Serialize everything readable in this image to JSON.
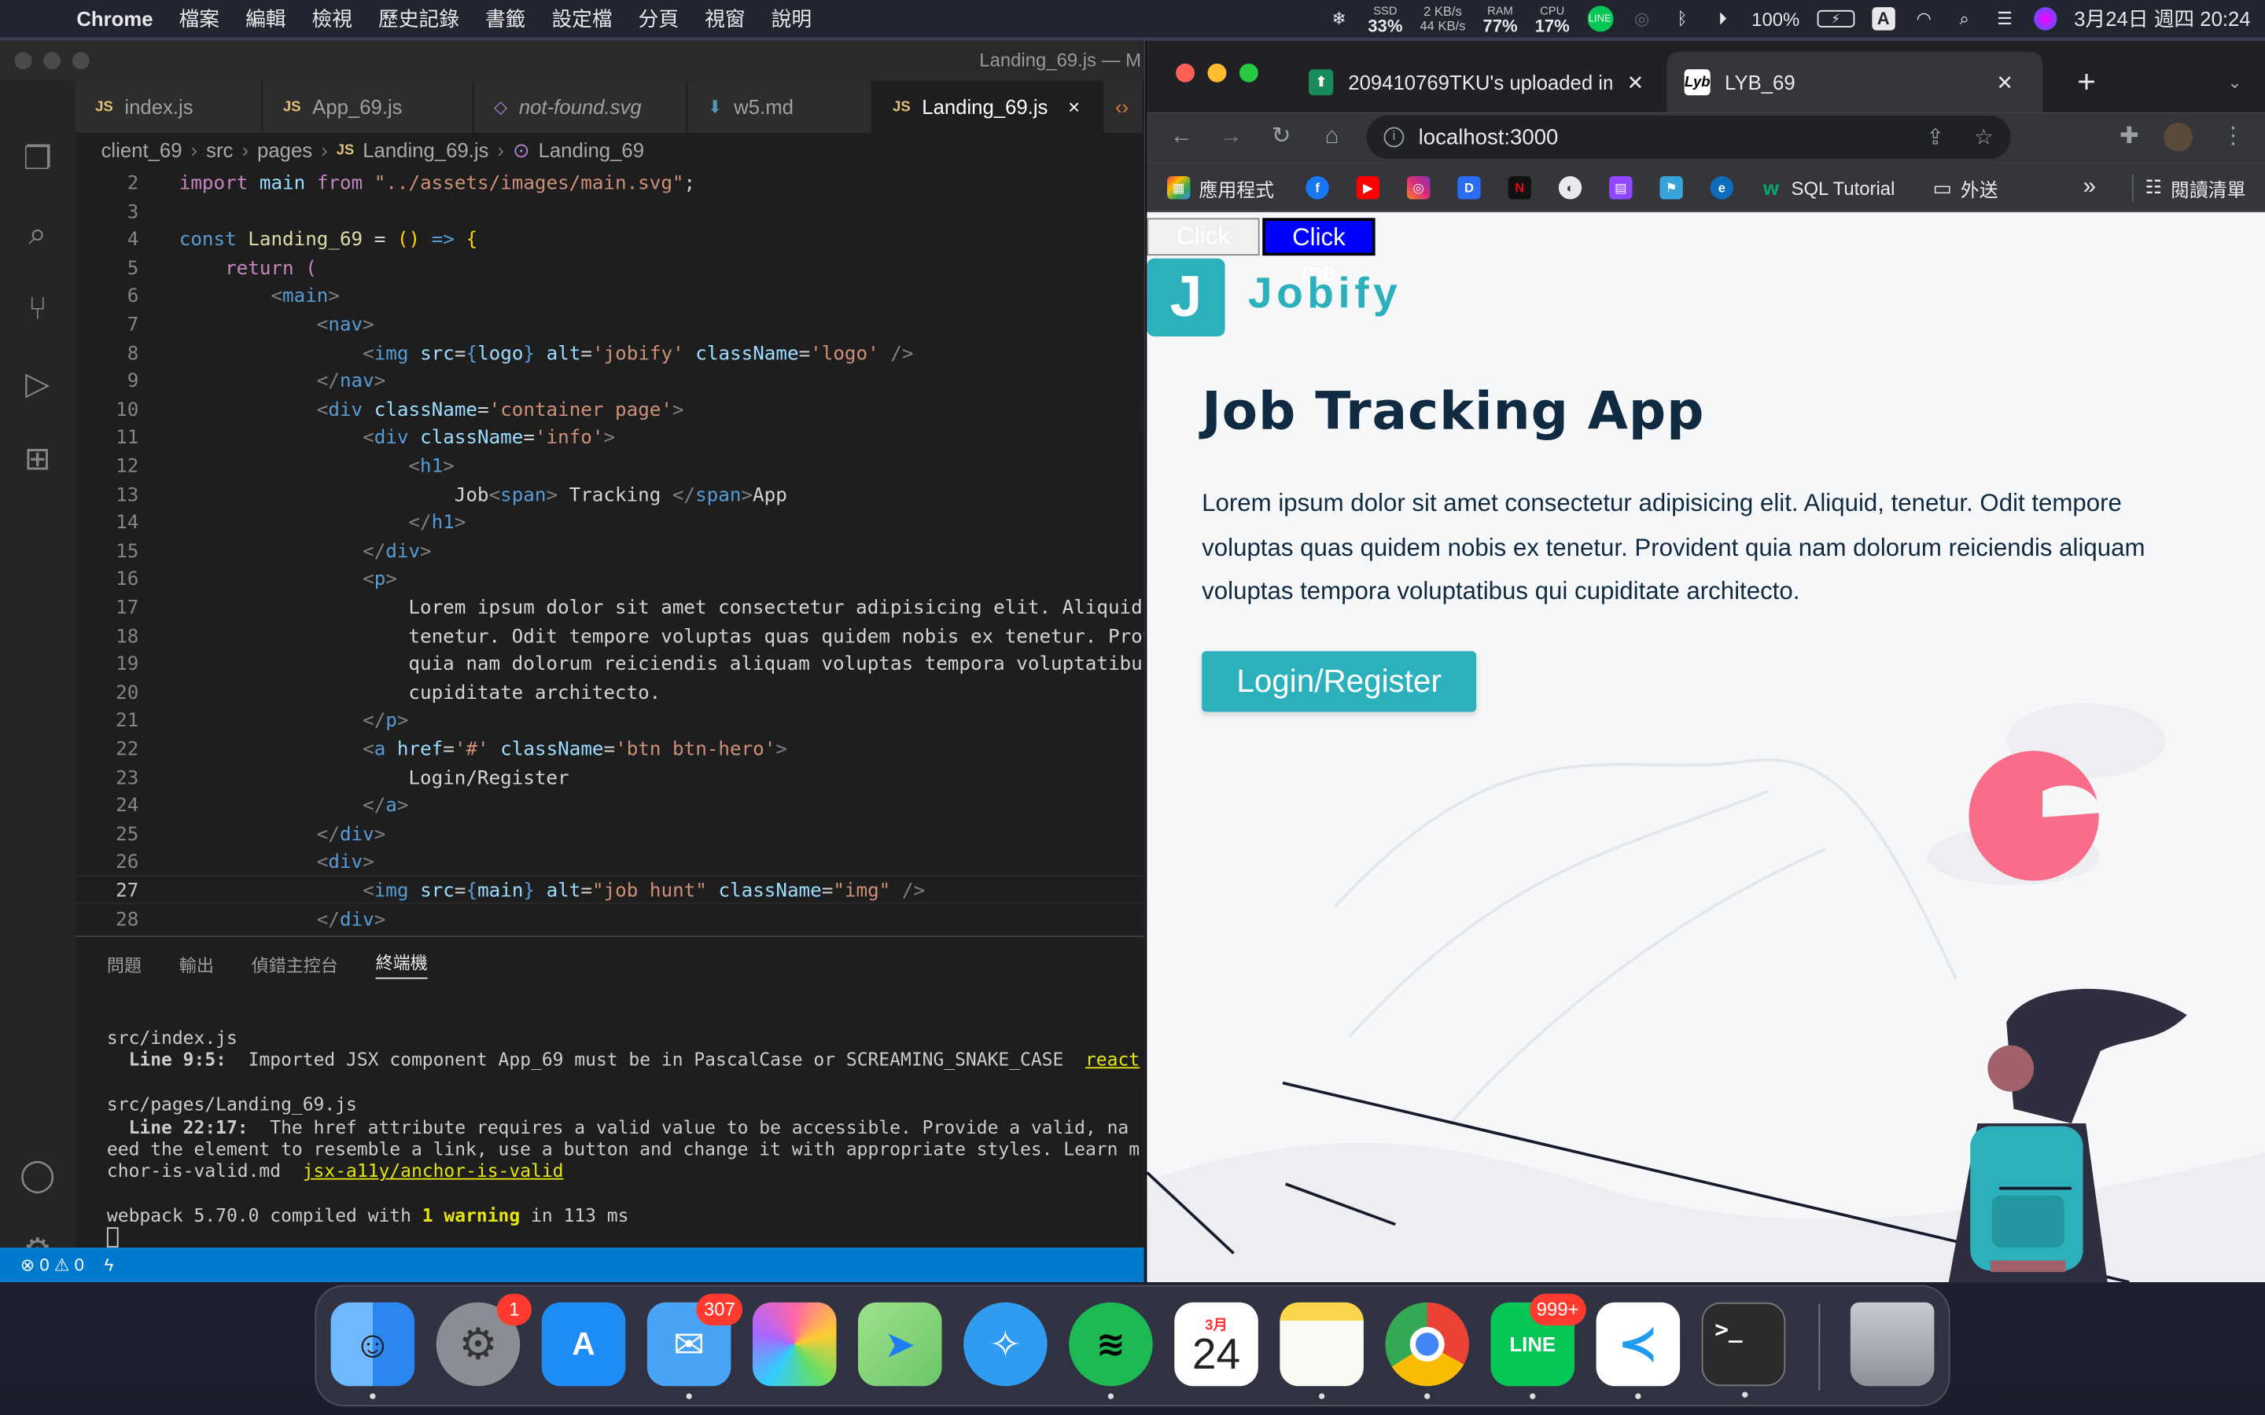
{
  "menubar": {
    "app": "Chrome",
    "items": [
      "檔案",
      "編輯",
      "檢視",
      "歷史記錄",
      "書籤",
      "設定檔",
      "分頁",
      "視窗",
      "說明"
    ],
    "ssd_label": "SSD",
    "ssd_value": "33%",
    "net_up": "2 KB/s",
    "net_down": "44 KB/s",
    "ram_label": "RAM",
    "ram_value": "77%",
    "cpu_label": "CPU",
    "cpu_value": "17%",
    "battery": "100%",
    "input_method": "A",
    "datetime": "3月24日 週四  20:24"
  },
  "vscode": {
    "window_title": "Landing_69.js — M",
    "tabs": [
      {
        "label": "index.js",
        "type": "JS"
      },
      {
        "label": "App_69.js",
        "type": "JS"
      },
      {
        "label": "not-found.svg",
        "type": "SVG"
      },
      {
        "label": "w5.md",
        "type": "MD"
      },
      {
        "label": "Landing_69.js",
        "type": "JS"
      }
    ],
    "tab_close": "×",
    "breadcrumb": [
      "client_69",
      "src",
      "pages",
      "Landing_69.js",
      "Landing_69"
    ],
    "line_numbers": [
      "2",
      "3",
      "4",
      "5",
      "6",
      "7",
      "8",
      "9",
      "10",
      "11",
      "12",
      "13",
      "14",
      "15",
      "16",
      "17",
      "18",
      "19",
      "20",
      "21",
      "22",
      "23",
      "24",
      "25",
      "26",
      "27",
      "28"
    ],
    "panel_tabs": [
      "問題",
      "輸出",
      "偵錯主控台",
      "終端機"
    ],
    "terminal": {
      "l1": "src/index.js",
      "l2_pre": "  Line 9:5:",
      "l2_msg": "  Imported JSX component App_69 must be in PascalCase or SCREAMING_SNAKE_CASE  ",
      "l2_rule": "react",
      "l3": "src/pages/Landing_69.js",
      "l4_pre": "  Line 22:17:",
      "l4_msg": "  The href attribute requires a valid value to be accessible. Provide a valid, na",
      "l5": "eed the element to resemble a link, use a button and change it with appropriate styles. Learn m",
      "l6_pre": "chor-is-valid.md  ",
      "l6_rule": "jsx-a11y/anchor-is-valid",
      "l7_pre": "webpack 5.70.0 compiled with ",
      "l7_warn": "1 warning",
      "l7_post": " in 113 ms"
    },
    "status": {
      "errors": "0",
      "warnings": "0"
    }
  },
  "chrome": {
    "tabs": [
      {
        "label": "209410769TKU's uploaded im"
      },
      {
        "label": "LYB_69"
      }
    ],
    "new_tab": "+",
    "url": "localhost:3000",
    "bookmarks": [
      "應用程式",
      "SQL Tutorial",
      "外送",
      "閱讀清單"
    ],
    "bookmarks_more": "»"
  },
  "page": {
    "button1": "Click me",
    "button2": "Click me",
    "logo_letter": "J",
    "logo_name": "Jobify",
    "title": "Job Tracking App",
    "text": "Lorem ipsum dolor sit amet consectetur adipisicing elit. Aliquid, tenetur. Odit tempore voluptas quas quidem nobis ex tenetur. Provident quia nam dolorum reiciendis aliquam voluptas tempora voluptatibus qui cupiditate architecto.",
    "cta": "Login/Register"
  },
  "dock": {
    "apps": [
      {
        "name": "Finder",
        "color": "#3a8ef0",
        "badge": ""
      },
      {
        "name": "System Preferences",
        "color": "#8a8d93",
        "badge": "1"
      },
      {
        "name": "App Store",
        "color": "#1e8cf5",
        "badge": ""
      },
      {
        "name": "Mail",
        "color": "#4aa3f5",
        "badge": "307"
      },
      {
        "name": "Photos",
        "color": "#ffffff",
        "badge": ""
      },
      {
        "name": "Maps",
        "color": "#6cc56a",
        "badge": ""
      },
      {
        "name": "Safari",
        "color": "#2f9cf2",
        "badge": ""
      },
      {
        "name": "Spotify",
        "color": "#1db954",
        "badge": ""
      },
      {
        "name": "Calendar",
        "color": "#ffffff",
        "badge": ""
      },
      {
        "name": "Notes",
        "color": "#f8d54a",
        "badge": ""
      },
      {
        "name": "Chrome",
        "color": "#ffffff",
        "badge": ""
      },
      {
        "name": "LINE",
        "color": "#06c755",
        "badge": "999+"
      },
      {
        "name": "VS Code",
        "color": "#ffffff",
        "badge": ""
      },
      {
        "name": "Terminal",
        "color": "#2b2b2b",
        "badge": ""
      },
      {
        "name": "Trash",
        "color": "#a3a7ad",
        "badge": ""
      }
    ],
    "calendar_month": "3月",
    "calendar_day": "24",
    "terminal_prompt": ">_"
  },
  "colors": {
    "brand": "#2cb1bc",
    "heading": "#102a42",
    "accent_pink": "#f96d8a"
  }
}
